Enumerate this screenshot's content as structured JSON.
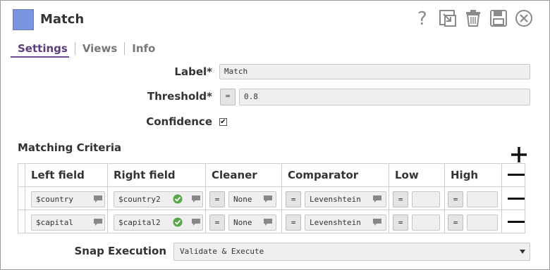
{
  "header": {
    "title": "Match",
    "swatch_color": "#7b96e0",
    "toolbar_icons": [
      "help-icon",
      "export-icon",
      "delete-icon",
      "save-icon",
      "close-icon"
    ]
  },
  "tabs": [
    {
      "label": "Settings",
      "active": true
    },
    {
      "label": "Views",
      "active": false
    },
    {
      "label": "Info",
      "active": false
    }
  ],
  "form": {
    "label_label": "Label*",
    "label_value": "Match",
    "threshold_label": "Threshold*",
    "threshold_eq": "=",
    "threshold_value": "0.8",
    "confidence_label": "Confidence",
    "confidence_checked": true,
    "confidence_mark": "✔"
  },
  "matching_criteria": {
    "title": "Matching Criteria",
    "columns": [
      "Left field",
      "Right field",
      "Cleaner",
      "Comparator",
      "Low",
      "High"
    ],
    "rows": [
      {
        "left": "$country",
        "right": "$country2",
        "cleaner_eq": "=",
        "cleaner": "None",
        "comparator_eq": "=",
        "comparator": "Levenshtein",
        "low_eq": "=",
        "low": "",
        "high_eq": "=",
        "high": ""
      },
      {
        "left": "$capital",
        "right": "$capital2",
        "cleaner_eq": "=",
        "cleaner": "None",
        "comparator_eq": "=",
        "comparator": "Levenshtein",
        "low_eq": "=",
        "low": "",
        "high_eq": "=",
        "high": ""
      }
    ]
  },
  "snap_execution": {
    "label": "Snap Execution",
    "value": "Validate & Execute"
  },
  "colors": {
    "accent": "#6a4b8f",
    "check_green": "#5aa64a",
    "field_bg": "#efefef"
  }
}
